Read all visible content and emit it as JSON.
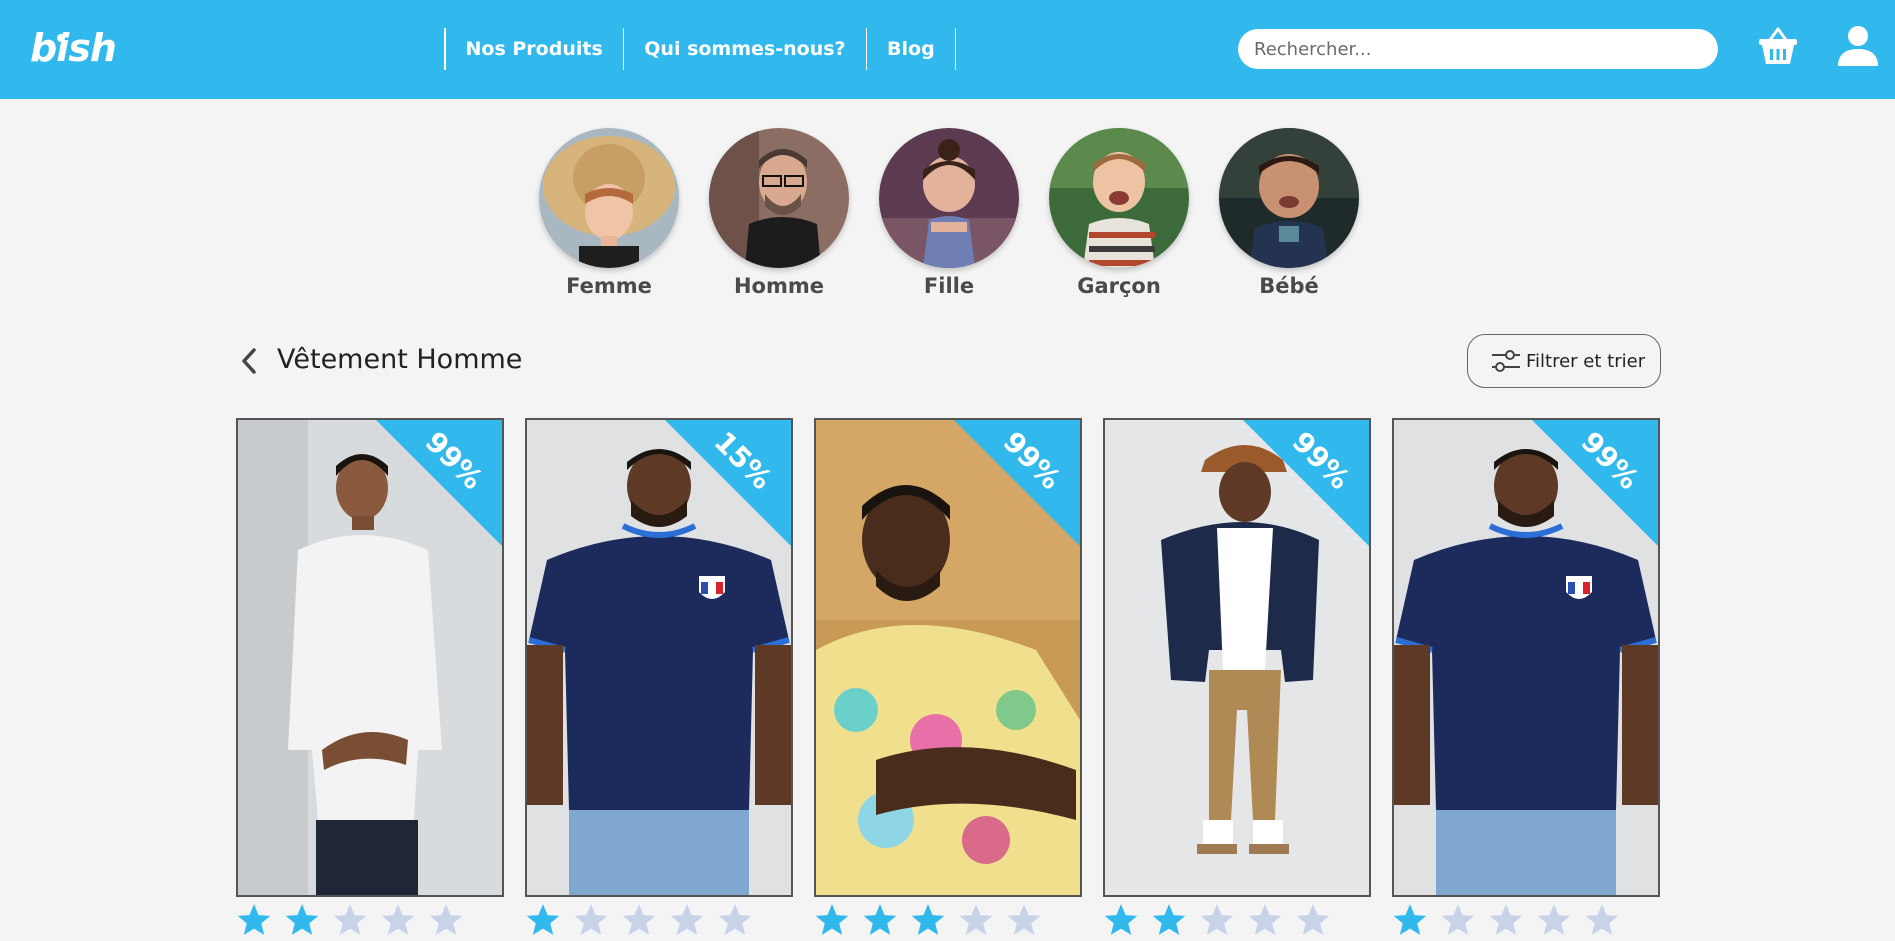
{
  "header": {
    "logo": "bish",
    "nav": [
      "Nos Produits",
      "Qui sommes-nous?",
      "Blog"
    ],
    "search_placeholder": "Rechercher...",
    "cart_icon": "basket-icon",
    "user_icon": "user-icon"
  },
  "categories": [
    "Femme",
    "Homme",
    "Fille",
    "Garçon",
    "Bébé"
  ],
  "section": {
    "title": "Vêtement Homme",
    "filter_label": "Filtrer et trier"
  },
  "products": [
    {
      "discount": "99%",
      "rating": 2
    },
    {
      "discount": "15%",
      "rating": 1
    },
    {
      "discount": "99%",
      "rating": 3
    },
    {
      "discount": "99%",
      "rating": 2
    },
    {
      "discount": "99%",
      "rating": 1
    }
  ],
  "colors": {
    "accent": "#31b8ec",
    "star_filled": "#31b8ec",
    "star_empty": "#c8d3ea"
  }
}
